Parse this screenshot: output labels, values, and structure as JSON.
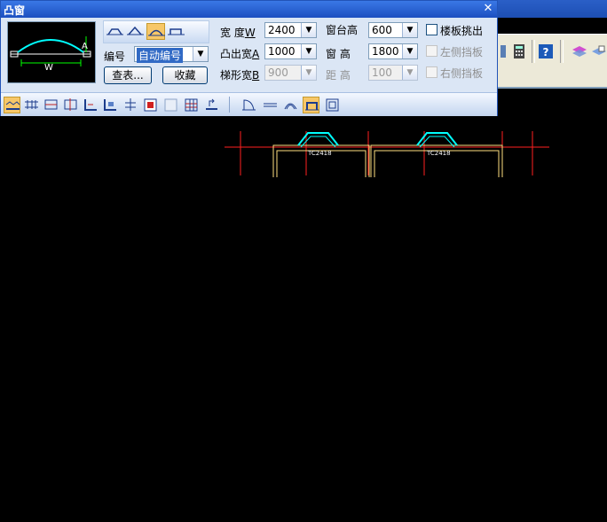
{
  "dialog": {
    "title": "凸窗",
    "close_icon": "close-icon",
    "labels": {
      "width": "宽  度",
      "width_key": "W",
      "protrude": "凸出宽",
      "protrude_key": "A",
      "trapezoid": "梯形宽",
      "trapezoid_key": "B",
      "sill_height": "窗台高",
      "window_height": "窗  高",
      "spacing": "距  高",
      "number": "编号"
    },
    "values": {
      "width": "2400",
      "protrude": "1000",
      "trapezoid": "900",
      "sill_height": "600",
      "window_height": "1800",
      "spacing": "100",
      "number": "自动编号"
    },
    "buttons": {
      "lookup": "查表...",
      "favorite": "收藏"
    },
    "checkboxes": {
      "floor_slab": "楼板挑出",
      "left_baffle": "左侧挡板",
      "right_baffle": "右侧挡板"
    },
    "preview_labels": {
      "a": "A",
      "w": "W"
    }
  },
  "cad": {
    "tag_left": "TC2418",
    "tag_right": "TC2418",
    "colors": {
      "axis": "#ff2020",
      "wall": "#ffe080",
      "window": "#00ffff",
      "text": "#ffffff"
    }
  },
  "colors": {
    "accent": "#2254b8",
    "active": "#f7c768",
    "canvas": "#000000"
  }
}
